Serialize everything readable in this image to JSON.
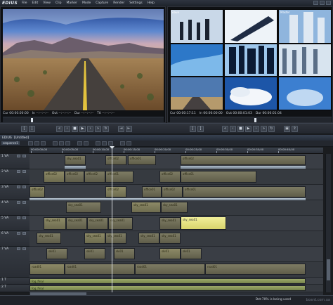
{
  "app": {
    "name": "EDIUS",
    "menu": [
      "File",
      "Edit",
      "View",
      "Clip",
      "Marker",
      "Mode",
      "Capture",
      "Render",
      "Settings",
      "Help"
    ]
  },
  "player": {
    "timecodes": {
      "cur": "Cur 00:00:00:00",
      "in": "In --:--:--:--",
      "out": "Out --:--:--:--",
      "dur": "Dur --:--:--:--",
      "ttl": "Ttl --:--:--:--"
    }
  },
  "recorder": {
    "labels": [
      "Slave",
      "Master"
    ],
    "timecodes": {
      "cur": "Cur 00:00:17:11",
      "in": "In 00:00:00:00",
      "out": "Out 00:00:01:03",
      "dur": "Dur 00:00:01:04"
    }
  },
  "timeline": {
    "window_title": "EDIUS",
    "sequence_tab": "sequence1",
    "sequence_name": "[Untitled]",
    "ruler": [
      "00:00:00;00",
      "00:00:05;00",
      "00:00:10;00",
      "00:00:15;00",
      "00:00:20;00",
      "00:00:25;00",
      "00:00:30;00",
      "00:00:35;00",
      "00:00:40;00"
    ],
    "tracks": [
      {
        "name": "1 VA"
      },
      {
        "name": "2 VA"
      },
      {
        "name": "3 VA"
      },
      {
        "name": "4 VA"
      },
      {
        "name": "5 VA"
      },
      {
        "name": "6 VA"
      },
      {
        "name": "7 VA"
      },
      {
        "name": "1 T"
      },
      {
        "name": "2 T"
      }
    ],
    "clips": {
      "t1": [
        {
          "label": "sky_sea01"
        },
        {
          "label": "office02"
        },
        {
          "label": "office01"
        },
        {
          "label": "office02"
        }
      ],
      "t2": [
        {
          "label": "office02"
        },
        {
          "label": "office02"
        },
        {
          "label": "office02"
        },
        {
          "label": "office01"
        },
        {
          "label": "office02"
        },
        {
          "label": "office01"
        }
      ],
      "t3": [
        {
          "label": "office02"
        },
        {
          "label": "office02"
        },
        {
          "label": "office01"
        },
        {
          "label": "office02"
        },
        {
          "label": "office01"
        }
      ],
      "t4": [
        {
          "label": "sky_sea01"
        },
        {
          "label": "sky_sea01"
        },
        {
          "label": "sky_sea01"
        }
      ],
      "t5": [
        {
          "label": "sky_sea01"
        },
        {
          "label": "sky_sea01"
        },
        {
          "label": "sky_sea01"
        },
        {
          "label": "sky_sea01"
        },
        {
          "label": "sky_sea01"
        },
        {
          "label": "sky_sea01"
        }
      ],
      "t6": [
        {
          "label": "sky_sea01"
        },
        {
          "label": "sky_sea01"
        },
        {
          "label": "sky_sea01"
        },
        {
          "label": "sky_sea01"
        },
        {
          "label": "sky_sea01"
        }
      ],
      "t7": [
        {
          "label": "ski01"
        },
        {
          "label": "ski01"
        },
        {
          "label": "ski01"
        },
        {
          "label": "ski01"
        },
        {
          "label": "ski01"
        }
      ],
      "t8": [
        {
          "label": "road01"
        },
        {
          "label": "road01"
        },
        {
          "label": "road01"
        },
        {
          "label": "road01"
        }
      ],
      "title1": [
        {
          "label": "fog_final"
        }
      ],
      "title2": [
        {
          "label": "fog_final"
        }
      ]
    }
  },
  "status": {
    "message": "Dst:70% is being used"
  },
  "watermark": "board.com.ua"
}
